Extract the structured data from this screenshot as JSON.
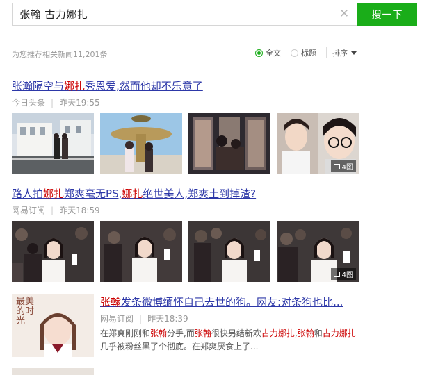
{
  "search": {
    "query": "张翰 古力娜扎",
    "button_label": "搜一下"
  },
  "filter": {
    "result_count": "为您推荐相关新闻11,201条",
    "option_full": "全文",
    "option_title": "标题",
    "sort_label": "排序"
  },
  "results": [
    {
      "title_parts": [
        "张瀚隔空与",
        "娜扎",
        "秀恩爱,然而他却不乐意了"
      ],
      "source": "今日头条",
      "time": "昨天19:55",
      "image_count": "4图"
    },
    {
      "title_parts": [
        "路人拍",
        "娜扎",
        "郑爽毫无PS,",
        "娜扎",
        "绝世美人,郑爽土到掉渣?"
      ],
      "source": "网易订阅",
      "time": "昨天18:59",
      "image_count": "4图"
    },
    {
      "title_parts": [
        "张翰",
        "发条微博缅怀自己去世的狗。网友:对条狗也比..."
      ],
      "source": "网易订阅",
      "time": "昨天18:39",
      "snippet_parts": [
        "在郑爽刚刚和",
        "张翰",
        "分手,而",
        "张翰",
        "很快另结新欢",
        "古力娜扎",
        ",",
        "张翰",
        "和",
        "古力娜扎",
        "几乎被粉丝黑了个彻底。在郑爽厌食上了..."
      ],
      "thumb_caption": "最美的时光"
    }
  ],
  "colors": {
    "accent": "#1aad19",
    "link": "#2d38a8",
    "highlight": "#cc0000"
  }
}
